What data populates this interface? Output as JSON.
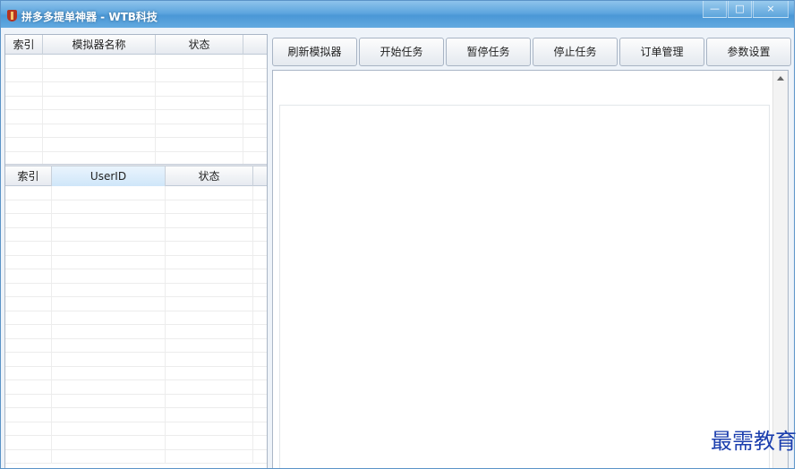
{
  "window": {
    "title": "拼多多提单神器 - WTB科技",
    "buttons": {
      "minimize": "—",
      "maximize": "□",
      "close": "×"
    }
  },
  "left_panel": {
    "emulator_table": {
      "columns": [
        "索引",
        "模拟器名称",
        "状态"
      ],
      "rows": []
    },
    "user_table": {
      "columns": [
        "索引",
        "UserID",
        "状态"
      ],
      "rows": []
    }
  },
  "toolbar": {
    "buttons": [
      "刷新模拟器",
      "开始任务",
      "暂停任务",
      "停止任务",
      "订单管理",
      "参数设置"
    ]
  },
  "watermark": {
    "text": "最需教育"
  },
  "colors": {
    "title_bar": "#4a97d6",
    "border": "#aab6c6",
    "watermark": "#1c3fae"
  }
}
